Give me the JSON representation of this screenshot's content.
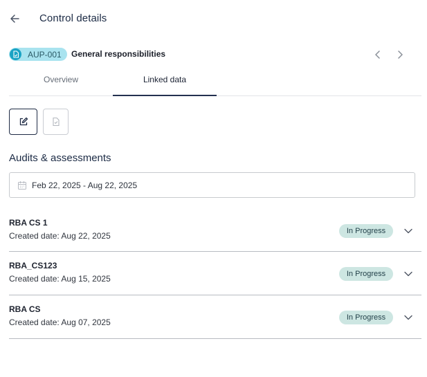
{
  "header": {
    "title": "Control details",
    "back_icon": "arrow-left-icon"
  },
  "control": {
    "code": "AUP-001",
    "name": "General responsibilities",
    "badge_color": "#a9e3ef",
    "badge_icon": "document-icon",
    "prev_icon": "chevron-left-icon",
    "next_icon": "chevron-right-icon"
  },
  "tabs": [
    {
      "label": "Overview",
      "active": false
    },
    {
      "label": "Linked data",
      "active": true
    }
  ],
  "toolbar": {
    "edit_icon": "edit-icon",
    "doc_check_icon": "document-check-icon"
  },
  "section": {
    "title": "Audits & assessments"
  },
  "date_range": {
    "value": "Feb 22, 2025 - Aug 22, 2025",
    "icon": "calendar-icon"
  },
  "audits": [
    {
      "name": "RBA CS 1",
      "created": "Created date: Aug 22, 2025",
      "status": "In Progress"
    },
    {
      "name": "RBA_CS123",
      "created": "Created date: Aug 15, 2025",
      "status": "In Progress"
    },
    {
      "name": "RBA CS",
      "created": "Created date: Aug 07, 2025",
      "status": "In Progress"
    }
  ],
  "colors": {
    "accent": "#1e2a44",
    "status_bg": "#cde6e2"
  }
}
